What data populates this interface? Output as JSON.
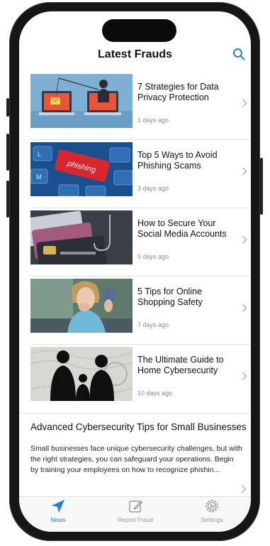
{
  "header": {
    "title": "Latest Frauds",
    "search_icon": "search-icon"
  },
  "articles": [
    {
      "title": "7 Strategies for Data Privacy Protection",
      "date": "1 days ago",
      "image": "hacker-fishing-laptop-image"
    },
    {
      "title": "Top 5 Ways to Avoid Phishing Scams",
      "date": "3 days ago",
      "image": "phishing-keyboard-key-image"
    },
    {
      "title": "How to Secure Your Social Media Accounts",
      "date": "5 days ago",
      "image": "credit-cards-hook-image"
    },
    {
      "title": "5 Tips for Online Shopping Safety",
      "date": "7 days ago",
      "image": "worried-woman-card-image"
    },
    {
      "title": "The Ultimate Guide to Home Cybersecurity",
      "date": "10 days ago",
      "image": "family-silhouette-money-image"
    }
  ],
  "featured": {
    "title": "Advanced Cybersecurity Tips for Small Businesses",
    "body": "Small businesses face unique cybersecurity challenges, but with the right strategies, you can safeguard your operations. Begin by training your employees on how to recognize phishin..."
  },
  "tabbar": {
    "active": "News",
    "accent": "#2a7be0",
    "items": [
      {
        "label": "News",
        "icon": "paper-plane-icon"
      },
      {
        "label": "Report Fraud",
        "icon": "edit-icon"
      },
      {
        "label": "Settings",
        "icon": "gear-icon"
      }
    ]
  }
}
